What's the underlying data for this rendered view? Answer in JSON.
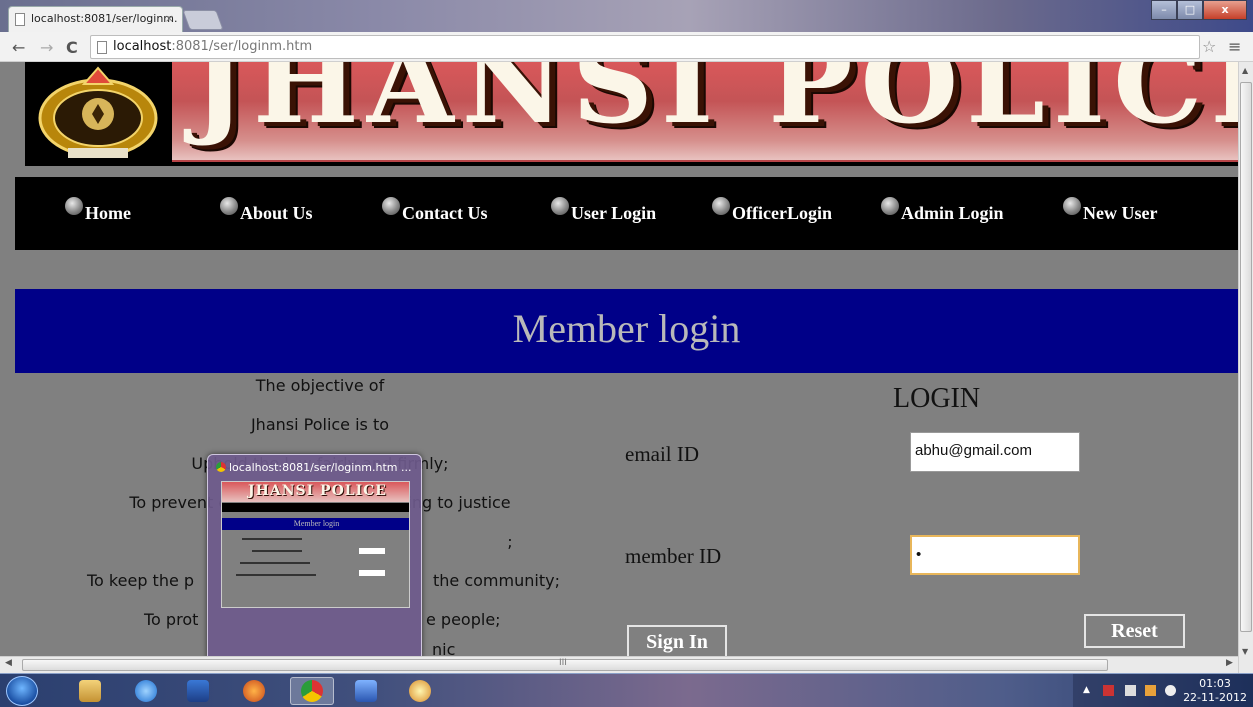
{
  "browser": {
    "tab_title": "localhost:8081/ser/loginm.",
    "tab_close": "×",
    "url_host": "localhost",
    "url_rest": ":8081/ser/loginm.htm",
    "back": "←",
    "forward": "→",
    "reload": "C",
    "star": "☆",
    "menu": "≡",
    "minimize": "–",
    "maximize": "□",
    "close": "x"
  },
  "banner": {
    "title": "JHANSI POLICE"
  },
  "nav": {
    "items": [
      {
        "label": "Home"
      },
      {
        "label": "About Us"
      },
      {
        "label": "Contact Us"
      },
      {
        "label": "User Login"
      },
      {
        "label": "OfficerLogin"
      },
      {
        "label": "Admin Login"
      },
      {
        "label": "New User"
      }
    ]
  },
  "main": {
    "heading": "Member login",
    "objective_lines": [
      "The objective of",
      "Jhansi Police is to",
      "Uphold the law fairly and firmly;",
      "To prevent crime; to pursue and bring to justice",
      ";",
      "To keep the p",
      "the community;",
      "To prot",
      "e people;",
      "nic"
    ]
  },
  "login": {
    "title": "LOGIN",
    "email_label": "email  ID",
    "email_value": "abhu@gmail.com",
    "member_label": "member ID",
    "member_value": "•",
    "signin_label": "Sign In",
    "reset_label": "Reset"
  },
  "thumbnail": {
    "title": "localhost:8081/ser/loginm.htm ...",
    "banner": "JHANSI POLICE",
    "heading": "Member login"
  },
  "scrollbar": {
    "grip": "III"
  },
  "taskbar": {
    "time": "01:03",
    "date": "22-11-2012"
  },
  "colors": {
    "page_bg": "#808080",
    "member_bar": "#000088",
    "banner_red": "#c45456",
    "nav_bg": "#000000"
  }
}
